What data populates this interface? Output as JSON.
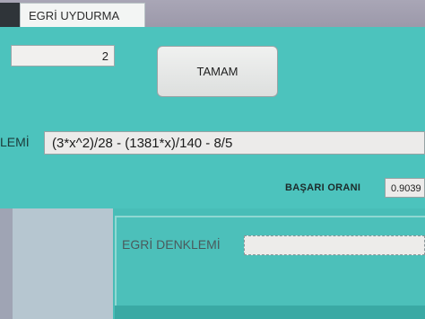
{
  "tab": {
    "label": "EGRİ UYDURMA"
  },
  "degree_input": {
    "value": "2"
  },
  "ok_button": {
    "label": "TAMAM"
  },
  "equation": {
    "label_fragment": "LEMİ",
    "value": "(3*x^2)/28 - (1381*x)/140 - 8/5"
  },
  "success_rate": {
    "label": "BAŞARI ORANI",
    "value": "0.9039"
  },
  "curve_equation": {
    "label": "EGRİ DENKLEMİ",
    "value": ""
  }
}
